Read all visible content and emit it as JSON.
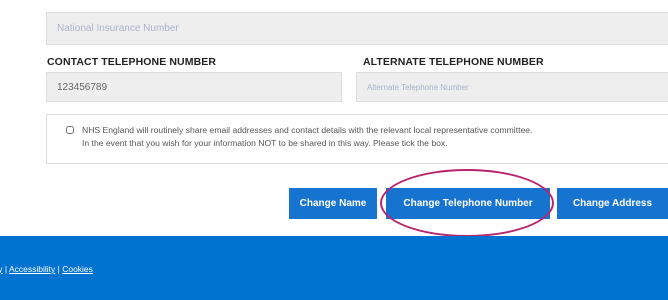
{
  "form": {
    "national_insurance_placeholder": "National Insurance Number",
    "contact_label": "CONTACT TELEPHONE NUMBER",
    "contact_value": "123456789",
    "alternate_label": "ALTERNATE TELEPHONE NUMBER",
    "alternate_placeholder": "Alternate Telephone Number",
    "consent_line1": "NHS England will routinely share email addresses and contact details with the relevant local representative committee.",
    "consent_line2": "In the event that you wish for your information NOT to be shared in this way. Please tick the box.",
    "consent_checked": false
  },
  "actions": {
    "change_name": "Change Name",
    "change_telephone": "Change Telephone Number",
    "change_address": "Change Address"
  },
  "footer": {
    "privacy": "cy",
    "separator": " | ",
    "accessibility": "Accessibility",
    "cookies": "Cookies"
  },
  "colors": {
    "button_blue": "#1673cf",
    "footer_blue": "#0072d0",
    "highlight": "#b8256c"
  }
}
